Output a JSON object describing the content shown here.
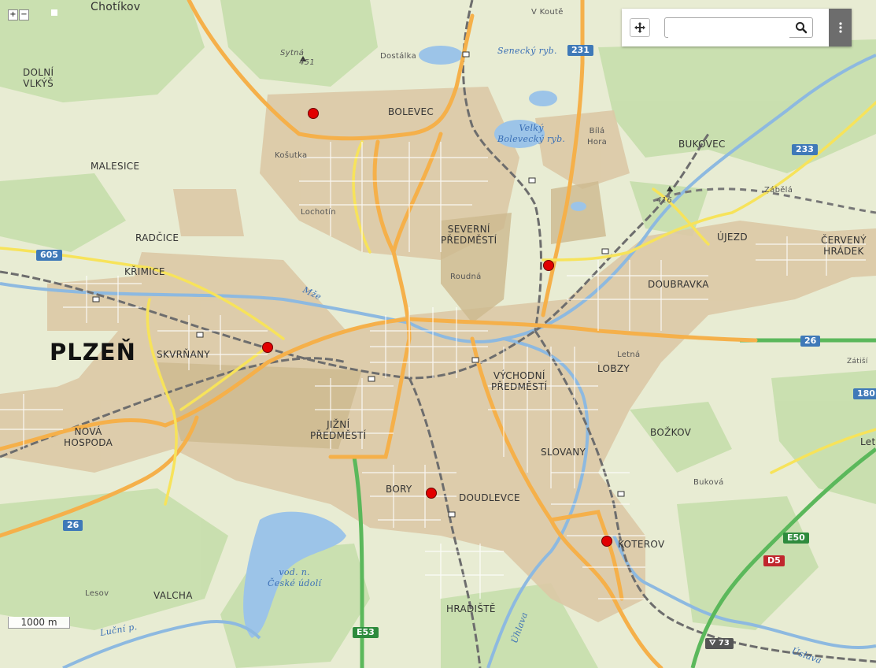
{
  "map_controls": {
    "zoom_in": "+",
    "zoom_out": "−",
    "search_value": "",
    "scale": "1000 m"
  },
  "places": {
    "chotikov": "Chotíkov",
    "dolni_vlkys": "DOLNÍ\nVLKÝŠ",
    "malesice": "MALESICE",
    "radcice": "RADČICE",
    "krimice": "KŘIMICE",
    "plzen": "PLZEŇ",
    "skvrnany": "SKVRŇANY",
    "nova_hospoda": "NOVÁ\nHOSPODA",
    "valcha": "VALCHA",
    "lesov": "Lesov",
    "bolevec": "BOLEVEC",
    "kosutka": "Košutka",
    "lochotin": "Lochotín",
    "dostalka": "Dostálka",
    "sytna": "Sytná",
    "sytna_height": "451",
    "v_koute": "V Koutě",
    "severni_predmesti": "SEVERNÍ\nPŘEDMĚSTÍ",
    "roudna": "Roudná",
    "jizni_predmesti": "JIŽNÍ\nPŘEDMĚSTÍ",
    "bory": "BORY",
    "doudlevce": "DOUDLEVCE",
    "hradiste": "HRADIŠTĚ",
    "vychodni_predmesti": "VÝCHODNÍ\nPŘEDMĚSTÍ",
    "slovany": "SLOVANY",
    "koterov": "KOTEROV",
    "lobzy": "LOBZY",
    "letna": "Letná",
    "doubravka": "DOUBRAVKA",
    "bukovec": "BUKOVEC",
    "bila_hora": "Bílá\nHora",
    "ujezd": "ÚJEZD",
    "cerveny_hradek": "ČERVENÝ\nHRÁDEK",
    "bozkov": "BOŽKOV",
    "bukova": "Buková",
    "zabela": "Zábělá",
    "height_416": "416",
    "zatis": "Zátiší",
    "let": "Let"
  },
  "water": {
    "senecky": "Senecký ryb.",
    "velky_bolevecky": "Velký\nBolevecký ryb.",
    "mze": "Mže",
    "ceske_udoli": "vod. n.\nČeské údolí",
    "lucni": "Luční p.",
    "uhlava": "Úhlava",
    "uslava": "Úslava"
  },
  "routes": {
    "r605": "605",
    "r26a": "26",
    "r26b": "26",
    "r231": "231",
    "r233": "233",
    "r180": "180",
    "e50": "E50",
    "d5": "D5",
    "e53": "E53",
    "d73": "73"
  },
  "colors": {
    "marker": "#e20000",
    "road_primary": "#f5b04a",
    "road_secondary": "#f7e35a",
    "motorway": "#5bb85b",
    "water": "#9cc4e8",
    "forest": "#c3dcaa",
    "urban": "#dcc9a6",
    "route_shield": "#3f79b8",
    "motorway_shield": "#2e8b3d",
    "d_shield": "#c0262d"
  },
  "markers": [
    {
      "name": "Bolevec"
    },
    {
      "name": "Skvrňany"
    },
    {
      "name": "Doubravka"
    },
    {
      "name": "Bory"
    },
    {
      "name": "Koterov"
    }
  ]
}
